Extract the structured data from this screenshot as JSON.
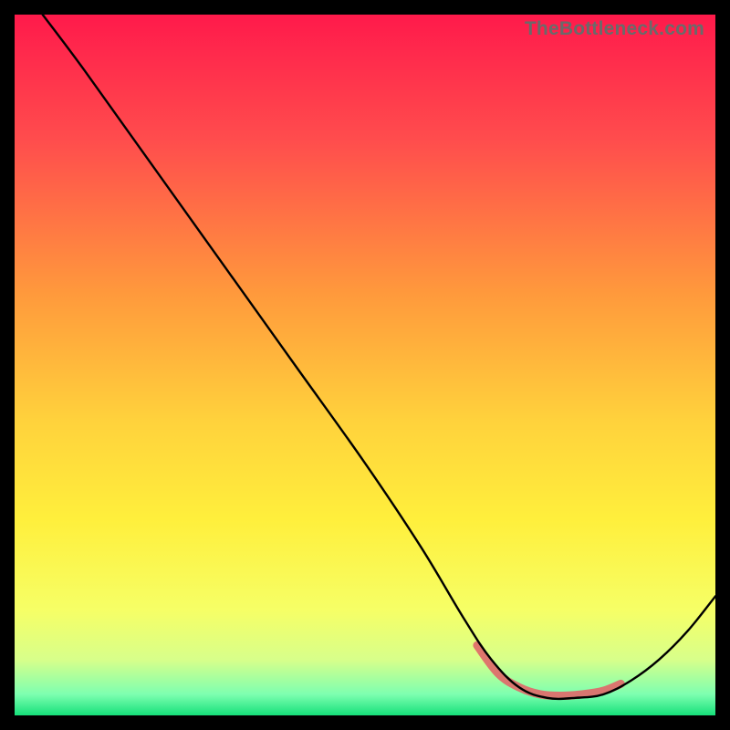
{
  "watermark": "TheBottleneck.com",
  "chart_data": {
    "type": "line",
    "title": "",
    "xlabel": "",
    "ylabel": "",
    "xlim": [
      0,
      100
    ],
    "ylim": [
      0,
      100
    ],
    "gradient_stops": [
      {
        "offset": 0,
        "color": "#ff1a4b"
      },
      {
        "offset": 18,
        "color": "#ff4d4d"
      },
      {
        "offset": 40,
        "color": "#ff9a3c"
      },
      {
        "offset": 58,
        "color": "#ffd23c"
      },
      {
        "offset": 72,
        "color": "#ffef3c"
      },
      {
        "offset": 85,
        "color": "#f6ff66"
      },
      {
        "offset": 92,
        "color": "#d8ff8a"
      },
      {
        "offset": 97,
        "color": "#7dffb0"
      },
      {
        "offset": 100,
        "color": "#16e07a"
      }
    ],
    "series": [
      {
        "name": "bottleneck-curve",
        "color": "#000000",
        "width": 2.4,
        "points": [
          {
            "x": 4,
            "y": 100
          },
          {
            "x": 10,
            "y": 92
          },
          {
            "x": 20,
            "y": 78
          },
          {
            "x": 30,
            "y": 64
          },
          {
            "x": 40,
            "y": 50
          },
          {
            "x": 50,
            "y": 36
          },
          {
            "x": 58,
            "y": 24
          },
          {
            "x": 64,
            "y": 14
          },
          {
            "x": 68,
            "y": 8
          },
          {
            "x": 72,
            "y": 4
          },
          {
            "x": 76,
            "y": 2.5
          },
          {
            "x": 80,
            "y": 2.5
          },
          {
            "x": 84,
            "y": 3
          },
          {
            "x": 88,
            "y": 5
          },
          {
            "x": 92,
            "y": 8
          },
          {
            "x": 96,
            "y": 12
          },
          {
            "x": 100,
            "y": 17
          }
        ]
      },
      {
        "name": "highlight-band",
        "color": "#e06a6a",
        "width": 9,
        "linecap": "round",
        "points": [
          {
            "x": 66,
            "y": 10
          },
          {
            "x": 69,
            "y": 6
          },
          {
            "x": 72,
            "y": 4
          },
          {
            "x": 75,
            "y": 3
          },
          {
            "x": 78,
            "y": 2.8
          },
          {
            "x": 81,
            "y": 3
          },
          {
            "x": 84,
            "y": 3.5
          },
          {
            "x": 86.5,
            "y": 4.5
          }
        ]
      }
    ]
  }
}
